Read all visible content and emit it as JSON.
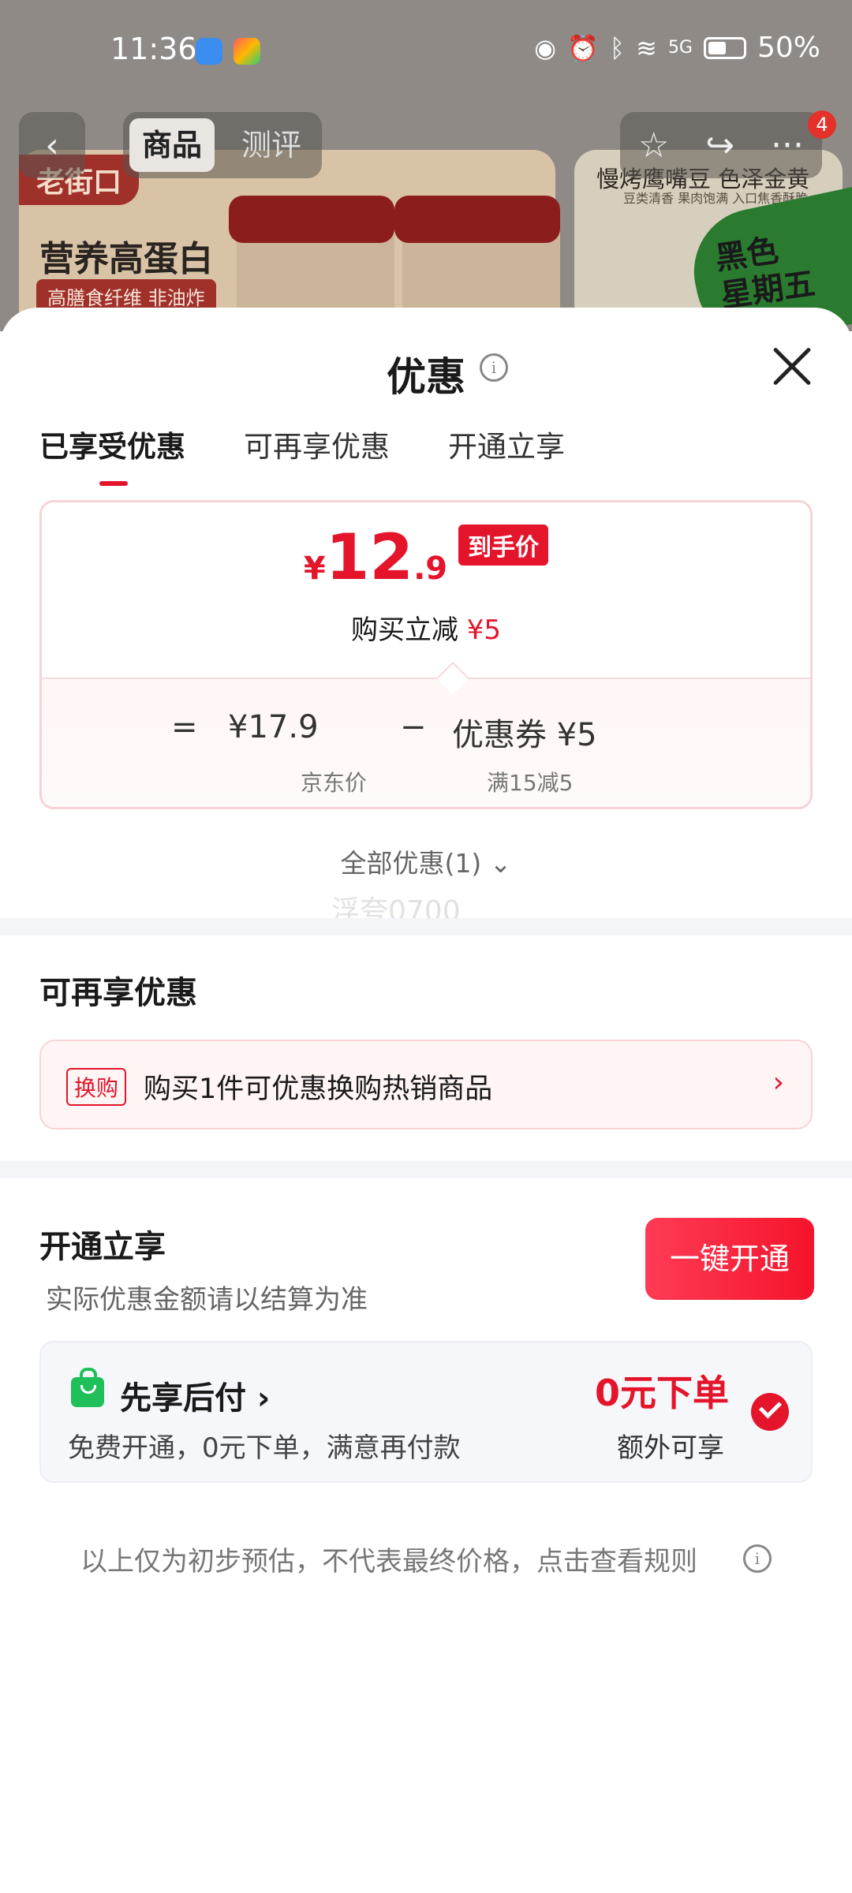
{
  "status_bar": {
    "time": "11:36",
    "battery": "50%",
    "network": "5G"
  },
  "background": {
    "nav_tabs": [
      "商品",
      "测评"
    ],
    "cart_badge": "4",
    "brand": "老街口",
    "headline": "营养高蛋白",
    "subline": "高膳食纤维 非油炸",
    "card2_title": "慢烤鹰嘴豆 色泽金黄",
    "card2_sub": "豆类清香 果肉饱满 入口焦香酥脆",
    "green_badge": [
      "黑色",
      "星期五"
    ]
  },
  "sheet": {
    "title": "优惠",
    "tabs": [
      "已享受优惠",
      "可再享优惠",
      "开通立享"
    ],
    "price": {
      "currency": "¥",
      "integer": "12",
      "decimal": ".9",
      "badge": "到手价",
      "buy_text": "购买立减",
      "buy_amount": "¥5",
      "equals": "=",
      "jd_price": "¥17.9",
      "minus": "−",
      "coupon": "优惠券 ¥5",
      "jd_label": "京东价",
      "coupon_label": "满15减5"
    },
    "all_deals": "全部优惠(1)",
    "watermark": "浮夸0700",
    "more_section": {
      "title": "可再享优惠",
      "tag": "换购",
      "text": "购买1件可优惠换购热销商品",
      "arrow": "›"
    },
    "open_section": {
      "title": "开通立享",
      "subtitle": "实际优惠金额请以结算为准",
      "button": "一键开通",
      "pay_title": "先享后付 ›",
      "pay_desc": "免费开通，0元下单，满意再付款",
      "zero_title": "0元下单",
      "zero_sub": "额外可享"
    },
    "disclaimer": "以上仅为初步预估，不代表最终价格，点击查看规则"
  }
}
